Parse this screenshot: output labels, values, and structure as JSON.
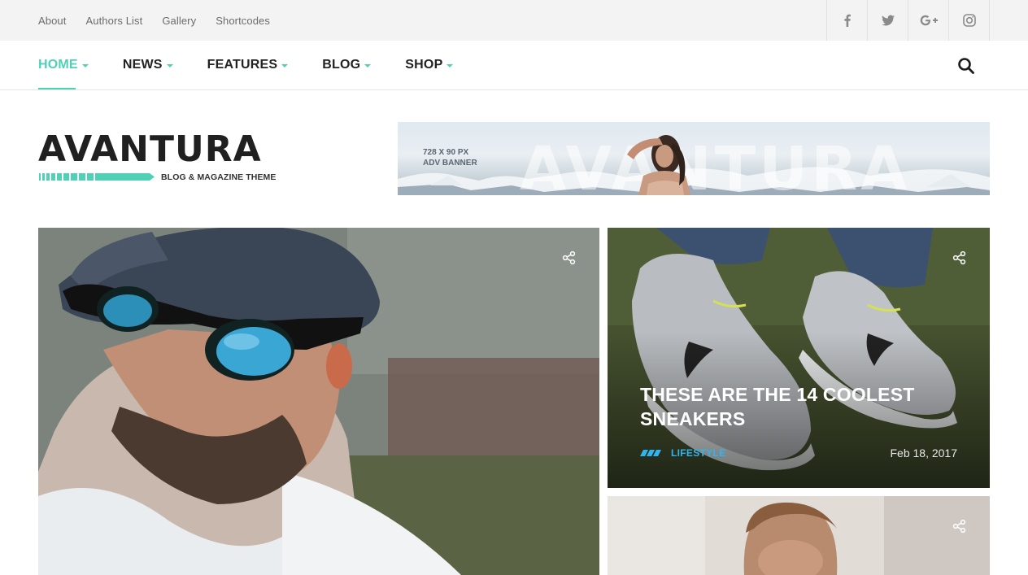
{
  "topbar": {
    "links": [
      "About",
      "Authors List",
      "Gallery",
      "Shortcodes"
    ],
    "social": [
      "facebook-icon",
      "twitter-icon",
      "google-plus-icon",
      "instagram-icon"
    ]
  },
  "nav": {
    "items": [
      {
        "label": "HOME",
        "active": true
      },
      {
        "label": "NEWS",
        "active": false
      },
      {
        "label": "FEATURES",
        "active": false
      },
      {
        "label": "BLOG",
        "active": false
      },
      {
        "label": "SHOP",
        "active": false
      }
    ],
    "search_icon": "search-icon",
    "accent": "#4fd1b5"
  },
  "logo": {
    "name": "AVANTURA",
    "tagline": "BLOG & MAGAZINE THEME"
  },
  "banner": {
    "line1": "728 X 90 PX",
    "line2": "ADV BANNER",
    "background_word": "AVANTURA"
  },
  "posts": {
    "featured": {
      "share_icon": "share-icon"
    },
    "side1": {
      "title": "THESE ARE THE 14 COOLEST SNEAKERS",
      "category": "LIFESTYLE",
      "date": "Feb 18, 2017",
      "category_color": "#2fb5f0"
    },
    "side2": {
      "share_icon": "share-icon"
    }
  }
}
